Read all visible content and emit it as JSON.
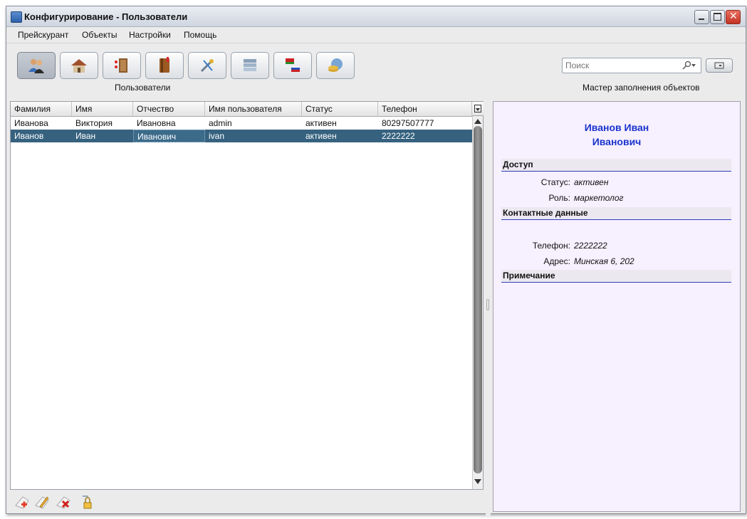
{
  "window": {
    "title": "Конфигурирование - Пользователи"
  },
  "menu": [
    "Прейскурант",
    "Объекты",
    "Настройки",
    "Помощь"
  ],
  "toolbar": {
    "buttons": [
      {
        "icon": "users-icon"
      },
      {
        "icon": "house-icon"
      },
      {
        "icon": "door-icon"
      },
      {
        "icon": "book-icon"
      },
      {
        "icon": "tools-icon"
      },
      {
        "icon": "database-icon"
      },
      {
        "icon": "flags-icon"
      },
      {
        "icon": "currency-icon"
      }
    ],
    "active_caption": "Пользователи"
  },
  "search": {
    "placeholder": "Поиск"
  },
  "wizard": {
    "caption": "Мастер заполнения объектов"
  },
  "table": {
    "columns": [
      "Фамилия",
      "Имя",
      "Отчество",
      "Имя пользователя",
      "Статус",
      "Телефон"
    ],
    "rows": [
      [
        "Иванова",
        "Виктория",
        "Ивановна",
        "admin",
        "активен",
        "80297507777"
      ],
      [
        "Иванов",
        "Иван",
        "Иванович",
        "ivan",
        "активен",
        "2222222"
      ]
    ],
    "selected_row": 1
  },
  "details": {
    "name_line1": "Иванов Иван",
    "name_line2": "Иванович",
    "sections": {
      "access": "Доступ",
      "contacts": "Контактные данные",
      "notes": "Примечание"
    },
    "fields": {
      "status_label": "Статус:",
      "status_value": "активен",
      "role_label": "Роль:",
      "role_value": "маркетолог",
      "phone_label": "Телефон:",
      "phone_value": "2222222",
      "address_label": "Адрес:",
      "address_value": "Минская 6, 202"
    }
  },
  "colors": {
    "selection": "#36627f",
    "detail_name": "#1a33cc",
    "detail_bg": "#f7f0ff"
  }
}
